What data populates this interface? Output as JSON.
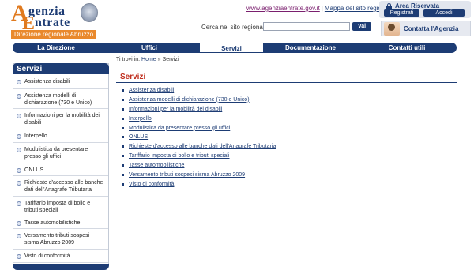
{
  "header": {
    "logo_a": "A",
    "logo_word1": "genzia",
    "logo_e": "E",
    "logo_word2": "ntrate",
    "region": "Direzione regionale Abruzzo",
    "site_link": "www.agenziaentrate.gov.it",
    "separator": "|",
    "map_link": "Mappa del sito regionale",
    "area_riservata": "Area Riservata",
    "registrati": "Registrati",
    "accedi": "Accedi",
    "search_label": "Cerca nel sito regionale:",
    "search_value": "",
    "search_button": "Vai",
    "contact": "Contatta l'Agenzia"
  },
  "nav": {
    "items": [
      "La Direzione",
      "Uffici",
      "Servizi",
      "Documentazione",
      "Contatti utili"
    ],
    "active": "Servizi"
  },
  "sidebar": {
    "title": "Servizi",
    "items": [
      "Assistenza disabili",
      "Assistenza modelli di dichiarazione (730 e Unico)",
      "Informazioni per la mobilità dei disabili",
      "Interpello",
      "Modulistica da presentare presso gli uffici",
      "ONLUS",
      "Richieste d'accesso alle banche dati dell'Anagrafe Tributaria",
      "Tariffario imposta di bollo e tributi speciali",
      "Tasse automobilistiche",
      "Versamento tributi sospesi sisma Abruzzo 2009",
      "Visto di conformità"
    ]
  },
  "breadcrumb": {
    "prefix": "Ti trovi in:",
    "home": "Home",
    "sep": "»",
    "current": "Servizi"
  },
  "main": {
    "title": "Servizi",
    "links": [
      "Assistenza disabili",
      "Assistenza modelli di dichiarazione (730 e Unico)",
      "Informazioni per la mobilità dei disabili",
      "Interpello",
      "Modulistica da presentare presso gli uffici",
      "ONLUS",
      "Richieste d'accesso alle banche dati dell'Anagrafe Tributaria",
      "Tariffario imposta di bollo e tributi speciali",
      "Tasse automobilistiche",
      "Versamento tributi sospesi sisma Abruzzo 2009",
      "Visto di conformità"
    ]
  },
  "colors": {
    "primary": "#1d3c74",
    "accent": "#e9892c",
    "title_red": "#c0301f"
  },
  "icons": [
    "agency-emblem-icon",
    "lock-icon",
    "contact-avatar-icon",
    "bullet-icon"
  ]
}
